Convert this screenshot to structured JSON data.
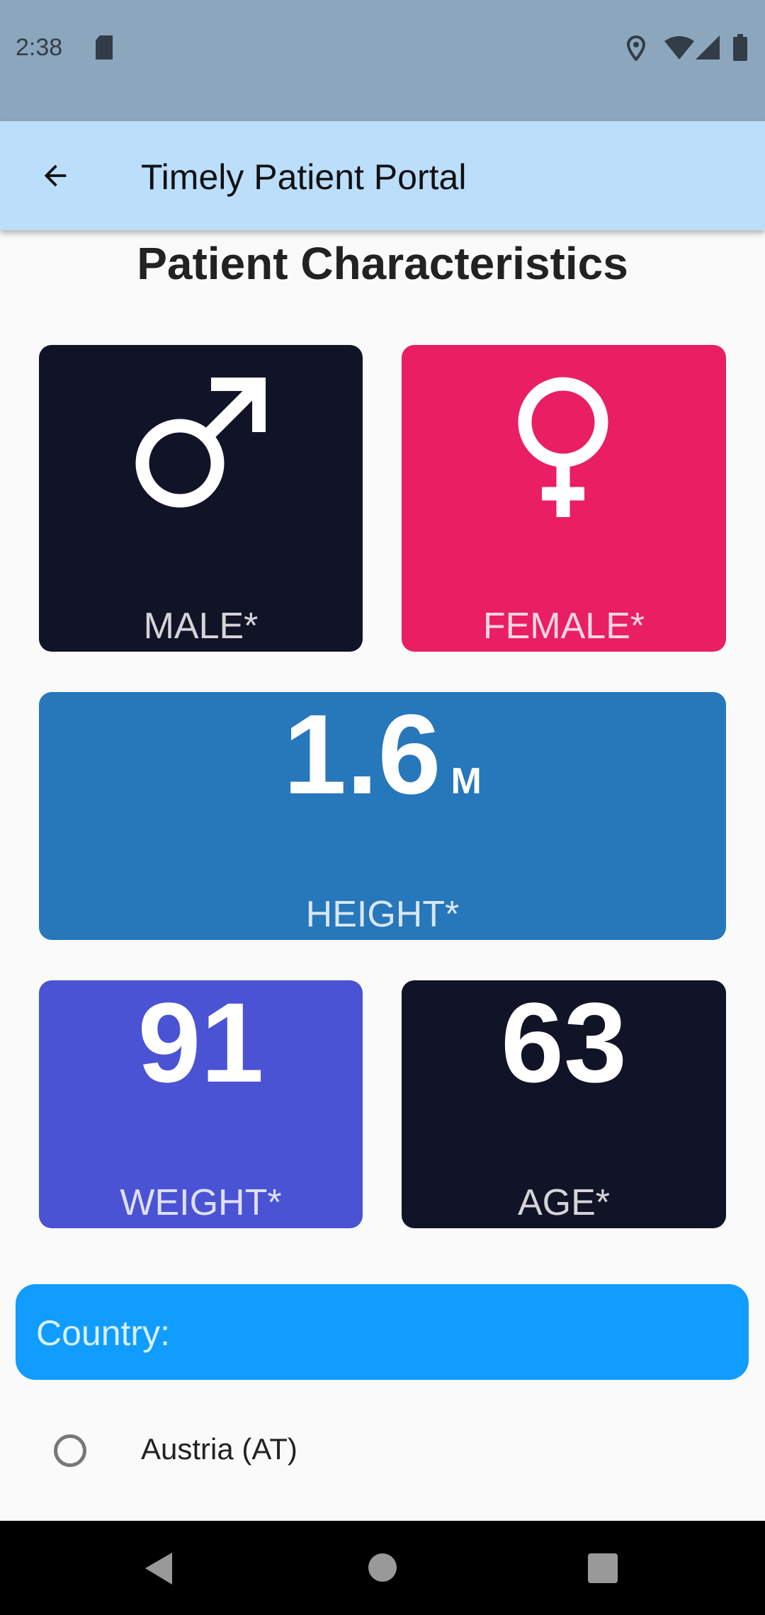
{
  "status_bar": {
    "time": "2:38"
  },
  "app_bar": {
    "title": "Timely Patient Portal"
  },
  "page": {
    "heading": "Patient Characteristics"
  },
  "cards": {
    "male": {
      "label": "MALE*",
      "color": "#111427"
    },
    "female": {
      "label": "FEMALE*",
      "color": "#e91e63"
    },
    "height": {
      "value": "1.6",
      "unit": "M",
      "label": "HEIGHT*",
      "color": "#2777bb"
    },
    "weight": {
      "value": "91",
      "label": "WEIGHT*",
      "color": "#4a53d4"
    },
    "age": {
      "value": "63",
      "label": "AGE*",
      "color": "#111427"
    }
  },
  "country": {
    "label": "Country:",
    "options": [
      {
        "label": "Austria (AT)",
        "selected": false
      }
    ]
  }
}
